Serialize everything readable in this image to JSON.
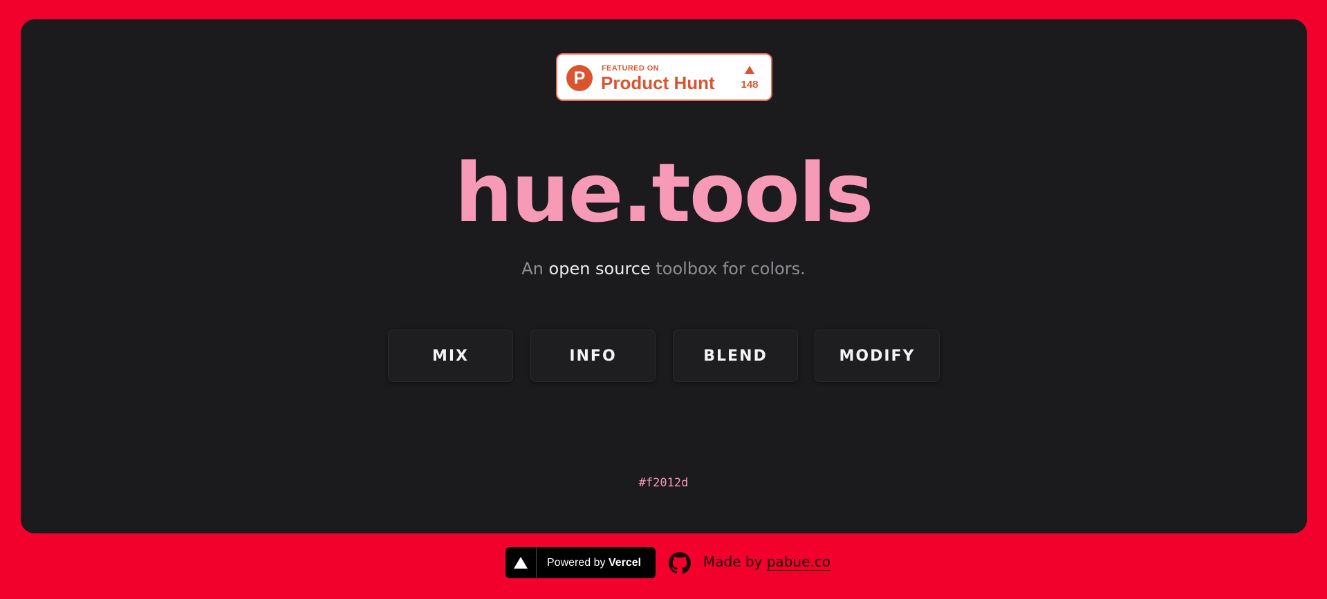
{
  "producthunt": {
    "featured_label": "FEATURED ON",
    "name": "Product Hunt",
    "logo_letter": "P",
    "upvotes": "148"
  },
  "hero": {
    "title": "hue.tools",
    "subtitle_prefix": "An ",
    "subtitle_highlight": "open source",
    "subtitle_suffix": " toolbox for colors."
  },
  "nav": {
    "buttons": [
      {
        "label": "MIX"
      },
      {
        "label": "INFO"
      },
      {
        "label": "BLEND"
      },
      {
        "label": "MODIFY"
      }
    ]
  },
  "current_color": "#f2012d",
  "footer": {
    "powered_by_prefix": "Powered by ",
    "powered_by_brand": "Vercel",
    "made_by_prefix": "Made by ",
    "made_by_link": "pabue.co"
  },
  "colors": {
    "background": "#f2012d",
    "card": "#1b1a1c",
    "accent_pink": "#f79ab8",
    "producthunt_orange": "#da552f"
  }
}
